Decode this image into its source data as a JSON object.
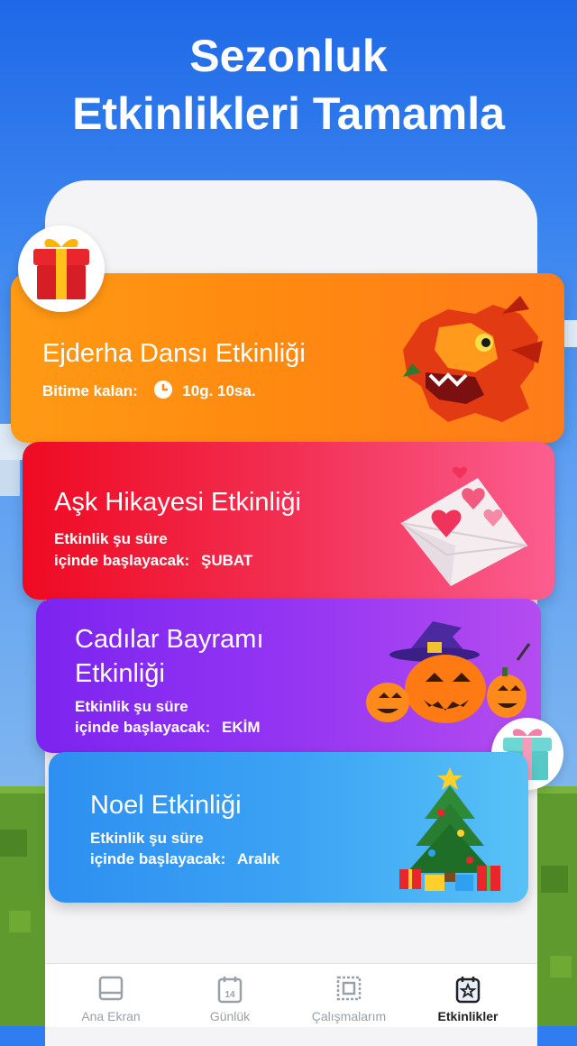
{
  "headline": {
    "line1": "Sezonluk",
    "line2": "Etkinlikleri Tamamla"
  },
  "events": [
    {
      "title": "Ejderha Dansı Etkinliği",
      "remaining_label": "Bitime kalan:",
      "remaining_value": "10g. 10sa.",
      "art": "dragon-head",
      "color": "#ff8a10"
    },
    {
      "title": "Aşk Hikayesi Etkinliği",
      "sub_line1": "Etkinlik şu süre",
      "sub_line2_prefix": "içinde başlayacak:",
      "start": "ŞUBAT",
      "art": "love-letter",
      "color": "#f22f52"
    },
    {
      "title_line1": "Cadılar Bayramı",
      "title_line2": "Etkinliği",
      "sub_line1": "Etkinlik şu süre",
      "sub_line2_prefix": "içinde başlayacak:",
      "start": "EKİM",
      "art": "pumpkins-witch-hat",
      "color": "#9435f2"
    },
    {
      "title": "Noel Etkinliği",
      "sub_line1": "Etkinlik şu süre",
      "sub_line2_prefix": "içinde başlayacak:",
      "start": "Aralık",
      "art": "christmas-tree",
      "color": "#3ba2f4"
    }
  ],
  "tabs": [
    {
      "label": "Ana Ekran",
      "icon": "home-icon"
    },
    {
      "label": "Günlük",
      "icon": "calendar-icon",
      "badge": "14"
    },
    {
      "label": "Çalışmalarım",
      "icon": "frame-icon"
    },
    {
      "label": "Etkinlikler",
      "icon": "event-star-icon",
      "active": true
    }
  ]
}
